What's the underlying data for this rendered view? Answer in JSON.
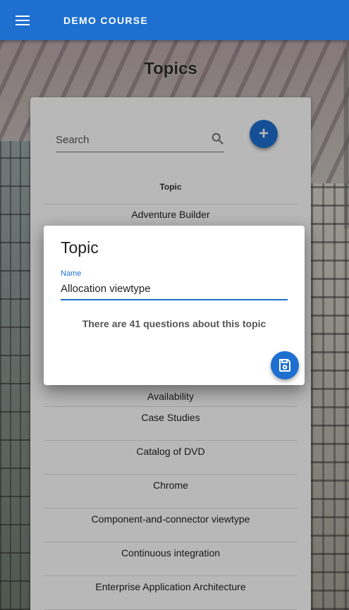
{
  "appbar": {
    "course_title": "DEMO COURSE"
  },
  "page": {
    "title": "Topics"
  },
  "search": {
    "placeholder": "Search"
  },
  "table": {
    "header": "Topic",
    "rows": [
      "Adventure Builder",
      "Availability",
      "Case Studies",
      "Catalog of DVD",
      "Chrome",
      "Component-and-connector viewtype",
      "Continuous integration",
      "Enterprise Application Architecture"
    ]
  },
  "dialog": {
    "title": "Topic",
    "name_label": "Name",
    "name_value": "Allocation viewtype",
    "question_count": "There are 41 questions about this topic"
  },
  "icons": {
    "menu": "menu-icon",
    "search": "search-icon",
    "add": "plus-icon",
    "save": "save-icon"
  },
  "colors": {
    "primary": "#1e6fd0"
  }
}
